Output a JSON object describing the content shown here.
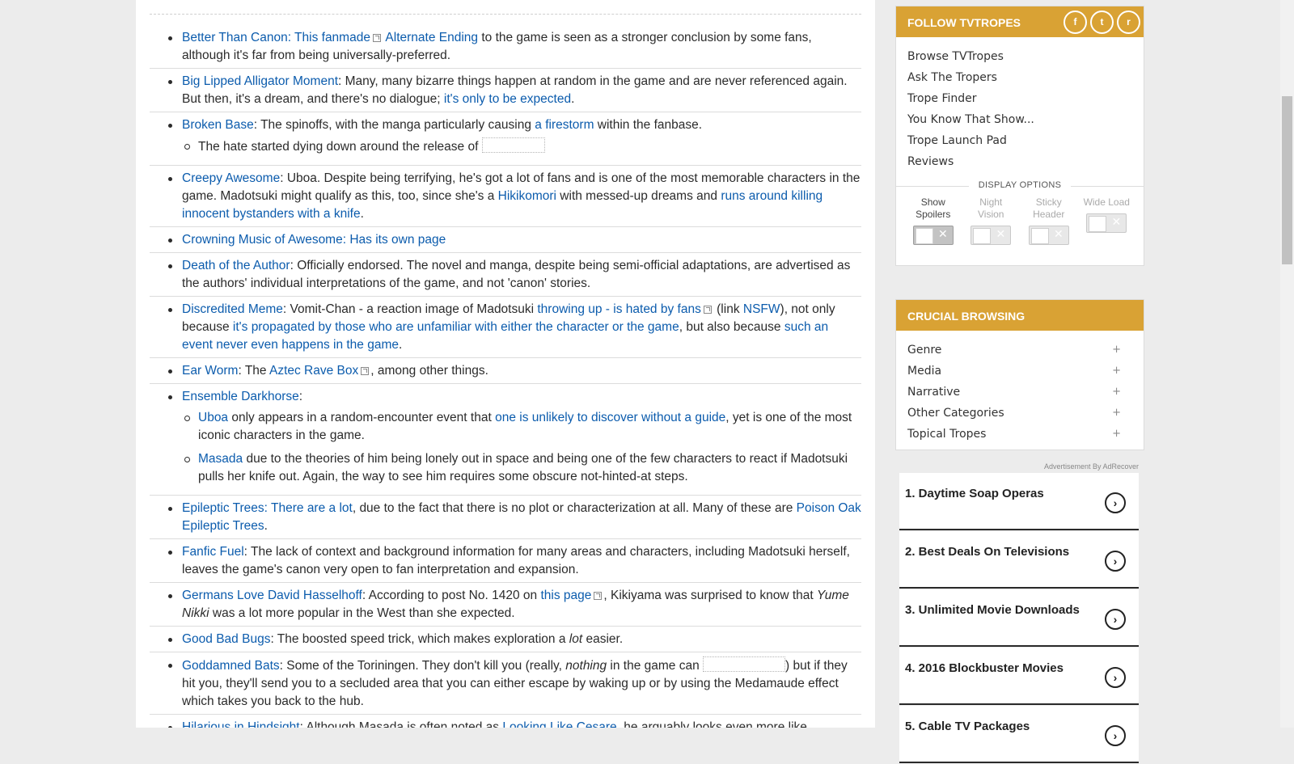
{
  "article": {
    "entries": [
      {
        "parts": [
          {
            "t": "Better Than Canon",
            "link": true
          },
          {
            "t": ": ",
            "link": true
          },
          {
            "t": "This fanmade",
            "link": true
          },
          {
            "icon": "external-link-icon"
          },
          {
            "t": " Alternate Ending",
            "link": true
          },
          {
            "t": " to the game is seen as a stronger conclusion by some fans, although it's far from being universally-preferred."
          }
        ]
      },
      {
        "parts": [
          {
            "t": "Big Lipped Alligator Moment",
            "link": true
          },
          {
            "t": ": Many, many bizarre things happen at random in the game and are never referenced again. But then, it's a dream, and there's no dialogue; "
          },
          {
            "t": "it's only to be expected",
            "link": true
          },
          {
            "t": "."
          }
        ]
      },
      {
        "parts": [
          {
            "t": "Broken Base",
            "link": true
          },
          {
            "t": ": The spinoffs, with the manga particularly causing "
          },
          {
            "t": "a firestorm",
            "link": true
          },
          {
            "t": " within the fanbase."
          }
        ],
        "sub": [
          {
            "parts": [
              {
                "t": "The hate started dying down around the release of "
              },
              {
                "spoiler": 76
              }
            ]
          }
        ]
      },
      {
        "parts": [
          {
            "t": "Creepy Awesome",
            "link": true
          },
          {
            "t": ": Uboa. Despite being terrifying, he's got a lot of fans and is one of the most memorable characters in the game. Madotsuki might qualify as this, too, since she's a "
          },
          {
            "t": "Hikikomori",
            "link": true
          },
          {
            "t": " with messed-up dreams and "
          },
          {
            "t": "runs around killing innocent bystanders with a knife",
            "link": true
          },
          {
            "t": "."
          }
        ]
      },
      {
        "parts": [
          {
            "t": "Crowning Music of Awesome",
            "link": true
          },
          {
            "t": ": ",
            "link": true
          },
          {
            "t": "Has its own page",
            "link": true
          }
        ]
      },
      {
        "parts": [
          {
            "t": "Death of the Author",
            "link": true
          },
          {
            "t": ": Officially endorsed. The novel and manga, despite being semi-official adaptations, are advertised as the authors' individual interpretations of the game, and not 'canon' stories."
          }
        ]
      },
      {
        "parts": [
          {
            "t": "Discredited Meme",
            "link": true
          },
          {
            "t": ": Vomit-Chan - a reaction image of Madotsuki "
          },
          {
            "t": "throwing up - is hated by fans",
            "link": true
          },
          {
            "icon": "external-link-icon"
          },
          {
            "t": " (link "
          },
          {
            "t": "NSFW",
            "link": true
          },
          {
            "t": "), not only because "
          },
          {
            "t": "it's propagated by those who are unfamiliar with either the character or the game",
            "link": true
          },
          {
            "t": ", but also because "
          },
          {
            "t": "such an event never even happens in the game",
            "link": true
          },
          {
            "t": "."
          }
        ]
      },
      {
        "parts": [
          {
            "t": "Ear Worm",
            "link": true
          },
          {
            "t": ": The "
          },
          {
            "t": "Aztec Rave Box",
            "link": true
          },
          {
            "icon": "external-link-icon"
          },
          {
            "t": ", among other things."
          }
        ]
      },
      {
        "parts": [
          {
            "t": "Ensemble Darkhorse",
            "link": true
          },
          {
            "t": ":"
          }
        ],
        "sub": [
          {
            "parts": [
              {
                "t": "Uboa",
                "link": true
              },
              {
                "t": " only appears in a random-encounter event that "
              },
              {
                "t": "one is unlikely to discover without a guide",
                "link": true
              },
              {
                "t": ", yet is one of the most iconic characters in the game."
              }
            ]
          },
          {
            "parts": [
              {
                "t": "Masada",
                "link": true
              },
              {
                "t": " due to the theories of him being lonely out in space and being one of the few characters to react if Madotsuki pulls her knife out. Again, the way to see him requires some obscure not-hinted-at steps."
              }
            ]
          }
        ]
      },
      {
        "parts": [
          {
            "t": "Epileptic Trees",
            "link": true
          },
          {
            "t": ": ",
            "link": true
          },
          {
            "t": "There are a lot",
            "link": true
          },
          {
            "t": ", due to the fact that there is no plot or characterization at all. Many of these are "
          },
          {
            "t": "Poison Oak Epileptic Trees",
            "link": true
          },
          {
            "t": "."
          }
        ]
      },
      {
        "parts": [
          {
            "t": "Fanfic Fuel",
            "link": true
          },
          {
            "t": ": The lack of context and background information for many areas and characters, including Madotsuki herself, leaves the game's canon very open to fan interpretation and expansion."
          }
        ]
      },
      {
        "parts": [
          {
            "t": "Germans Love David Hasselhoff",
            "link": true
          },
          {
            "t": ": According to post No. 1420 on "
          },
          {
            "t": "this page",
            "link": true
          },
          {
            "icon": "external-link-icon"
          },
          {
            "t": ", Kikiyama was surprised to know that "
          },
          {
            "t": "Yume Nikki",
            "italic": true
          },
          {
            "t": " was a lot more popular in the West than she expected."
          }
        ]
      },
      {
        "parts": [
          {
            "t": "Good Bad Bugs",
            "link": true
          },
          {
            "t": ": The boosted speed trick, which makes exploration a "
          },
          {
            "t": "lot",
            "italic": true
          },
          {
            "t": " easier."
          }
        ]
      },
      {
        "parts": [
          {
            "t": "Goddamned Bats",
            "link": true
          },
          {
            "t": ": Some of the Toriningen. They don't kill you (really, "
          },
          {
            "t": "nothing",
            "italic": true
          },
          {
            "t": " in the game can "
          },
          {
            "spoiler": 100
          },
          {
            "t": ") but if they hit you, they'll send you to a secluded area that you can either escape by waking up or by using the Medamaude effect which takes you back to the hub."
          }
        ]
      },
      {
        "parts": [
          {
            "t": "Hilarious in Hindsight",
            "link": true
          },
          {
            "t": ": Although Masada is often noted as "
          },
          {
            "t": "Looking Like Cesare",
            "link": true
          },
          {
            "t": ", he arguably looks even more like"
          }
        ]
      }
    ]
  },
  "follow": {
    "title": "FOLLOW TVTROPES",
    "social": [
      {
        "icon": "facebook-icon",
        "glyph": "f"
      },
      {
        "icon": "twitter-icon",
        "glyph": "t"
      },
      {
        "icon": "reddit-icon",
        "glyph": "r"
      }
    ],
    "links": [
      "Browse TVTropes",
      "Ask The Tropers",
      "Trope Finder",
      "You Know That Show...",
      "Trope Launch Pad",
      "Reviews"
    ]
  },
  "display_options": {
    "title": "DISPLAY OPTIONS",
    "toggles": [
      {
        "label": "Show Spoilers",
        "on": true
      },
      {
        "label": "Night Vision",
        "on": false
      },
      {
        "label": "Sticky Header",
        "on": false
      },
      {
        "label": "Wide Load",
        "on": false
      }
    ]
  },
  "crucial": {
    "title": "CRUCIAL BROWSING",
    "items": [
      "Genre",
      "Media",
      "Narrative",
      "Other Categories",
      "Topical Tropes"
    ]
  },
  "ads": {
    "label": "Advertisement By AdRecover",
    "items": [
      "1. Daytime Soap Operas",
      "2. Best Deals On Televisions",
      "3. Unlimited Movie Downloads",
      "4. 2016 Blockbuster Movies",
      "5. Cable TV Packages"
    ]
  },
  "colors": {
    "accent": "#d9a234",
    "link": "#0c5cad",
    "text": "#2b2b2b"
  }
}
